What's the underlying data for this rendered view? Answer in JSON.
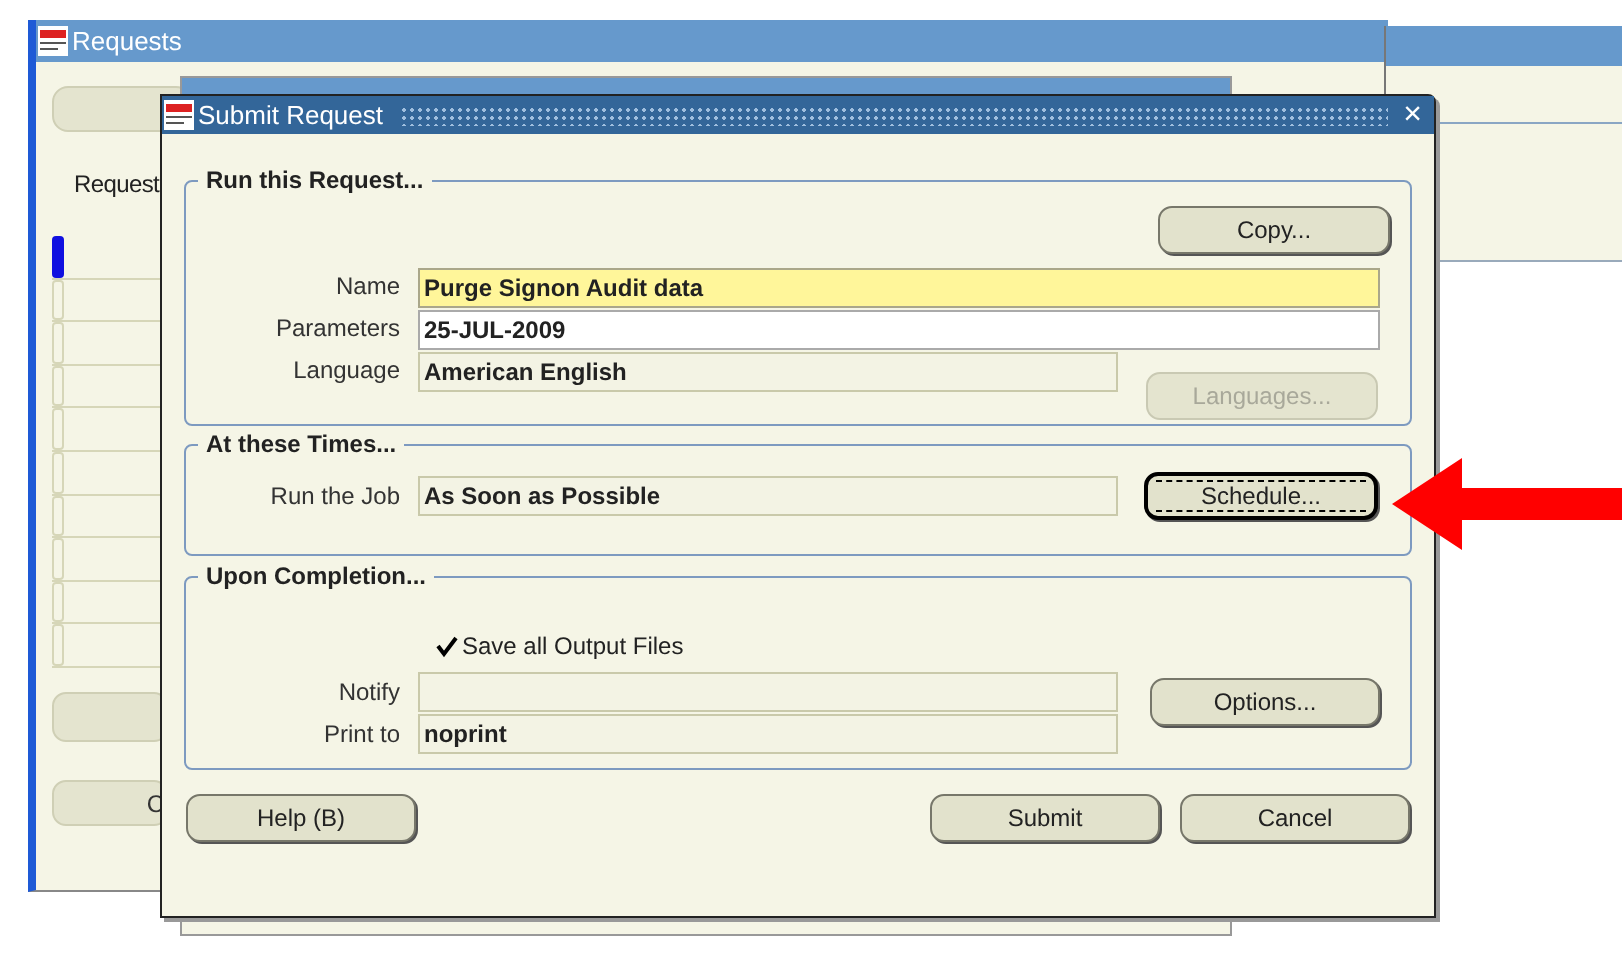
{
  "requests_window": {
    "title": "Requests",
    "label": "Request",
    "button_label": "C",
    "rows": [
      {
        "selected": true
      },
      {
        "selected": false
      },
      {
        "selected": false
      },
      {
        "selected": false
      },
      {
        "selected": false
      },
      {
        "selected": false
      },
      {
        "selected": false
      },
      {
        "selected": false
      },
      {
        "selected": false
      },
      {
        "selected": false
      }
    ]
  },
  "dialog": {
    "title": "Submit Request",
    "close": "×",
    "run_group": {
      "title": "Run this Request...",
      "fields": [
        {
          "label": "Name",
          "value": "Purge Signon Audit data",
          "kind": "required"
        },
        {
          "label": "Parameters",
          "value": "25-JUL-2009",
          "kind": "editable"
        },
        {
          "label": "Language",
          "value": "American English",
          "kind": "readonly"
        }
      ],
      "copy_button": {
        "label": "Copy...",
        "disabled": false,
        "focused": false
      },
      "languages_button": {
        "label": "Languages...",
        "disabled": true,
        "focused": false
      }
    },
    "times_group": {
      "title": "At these Times...",
      "field": {
        "label": "Run the Job",
        "value": "As Soon as Possible",
        "kind": "readonly"
      },
      "schedule_button": {
        "label": "Schedule...",
        "disabled": false,
        "focused": true
      }
    },
    "completion_group": {
      "title": "Upon Completion...",
      "save_output": {
        "label": "Save all Output Files",
        "checked": true
      },
      "fields": [
        {
          "label": "Notify",
          "kind": "readonly"
        },
        {
          "label": "Print to",
          "value": "noprint",
          "kind": "readonly"
        }
      ],
      "options_button": {
        "label": "Options...",
        "disabled": false,
        "focused": false
      }
    },
    "buttons": [
      {
        "label": "Help (B)",
        "disabled": false,
        "focused": false
      },
      {
        "label": "Submit",
        "disabled": false,
        "focused": false
      },
      {
        "label": "Cancel",
        "disabled": false,
        "focused": false
      }
    ]
  }
}
